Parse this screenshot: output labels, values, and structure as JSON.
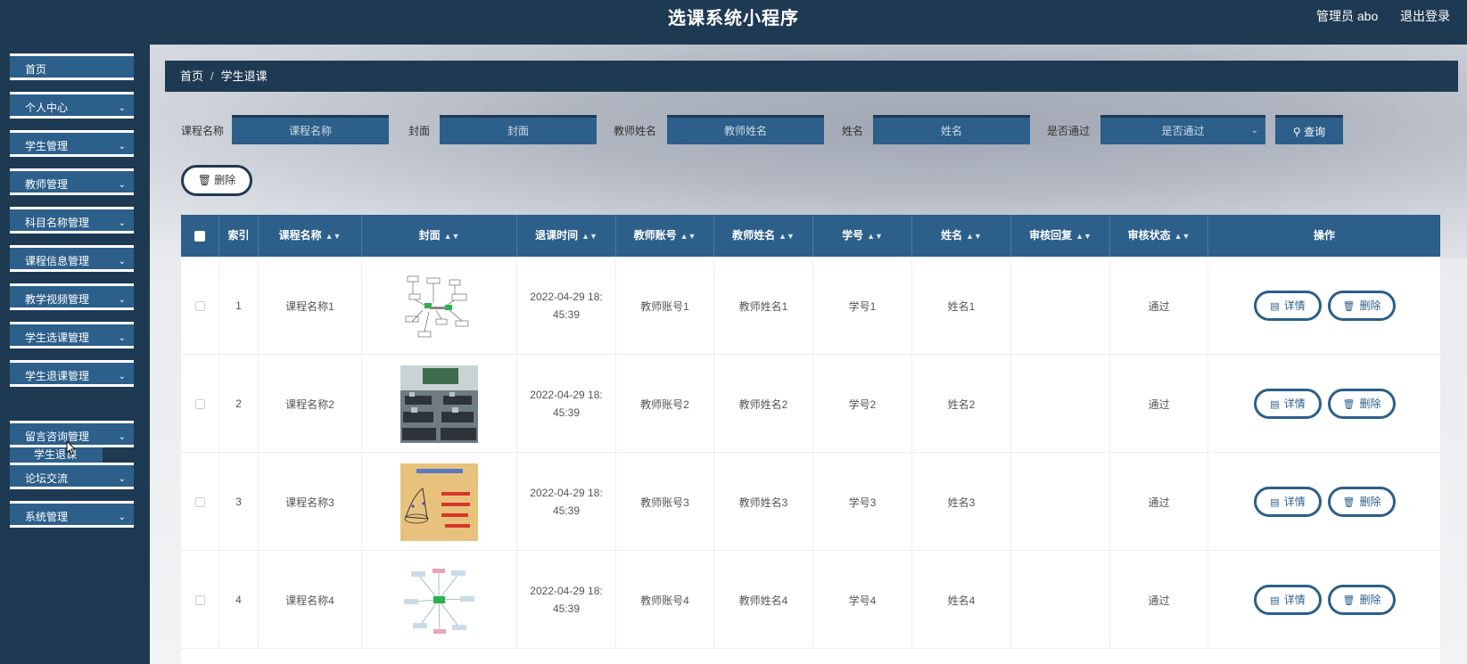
{
  "header": {
    "title": "选课系统小程序",
    "user": "管理员 abo",
    "logout": "退出登录"
  },
  "sidebar": {
    "items": [
      {
        "label": "首页",
        "expandable": false
      },
      {
        "label": "个人中心",
        "expandable": true
      },
      {
        "label": "学生管理",
        "expandable": true
      },
      {
        "label": "教师管理",
        "expandable": true
      },
      {
        "label": "科目名称管理",
        "expandable": true
      },
      {
        "label": "课程信息管理",
        "expandable": true
      },
      {
        "label": "教学视频管理",
        "expandable": true
      },
      {
        "label": "学生选课管理",
        "expandable": true
      },
      {
        "label": "学生退课管理",
        "expandable": true
      },
      {
        "label": "留言咨询管理",
        "expandable": true
      },
      {
        "label": "论坛交流",
        "expandable": true
      },
      {
        "label": "系统管理",
        "expandable": true
      }
    ],
    "sub_item": "学生退课"
  },
  "breadcrumb": {
    "home": "首页",
    "separator": "/",
    "current": "学生退课"
  },
  "filters": {
    "course_label": "课程名称",
    "course_placeholder": "课程名称",
    "cover_label": "封面",
    "cover_placeholder": "封面",
    "teacher_label": "教师姓名",
    "teacher_placeholder": "教师姓名",
    "name_label": "姓名",
    "name_placeholder": "姓名",
    "pass_label": "是否通过",
    "pass_placeholder": "是否通过",
    "query_button": "查询"
  },
  "bulk_delete": "删除",
  "table": {
    "headers": [
      "索引",
      "课程名称",
      "封面",
      "退课时间",
      "教师账号",
      "教师姓名",
      "学号",
      "姓名",
      "审核回复",
      "审核状态",
      "操作"
    ],
    "rows": [
      {
        "index": "1",
        "course": "课程名称1",
        "time_date": "2022-04-29 18:",
        "time_rest": "45:39",
        "teacher_account": "教师账号1",
        "teacher_name": "教师姓名1",
        "student_no": "学号1",
        "name": "姓名1",
        "reply": "",
        "status": "通过",
        "cover": "diagram"
      },
      {
        "index": "2",
        "course": "课程名称2",
        "time_date": "2022-04-29 18:",
        "time_rest": "45:39",
        "teacher_account": "教师账号2",
        "teacher_name": "教师姓名2",
        "student_no": "学号2",
        "name": "姓名2",
        "reply": "",
        "status": "通过",
        "cover": "classroom"
      },
      {
        "index": "3",
        "course": "课程名称3",
        "time_date": "2022-04-29 18:",
        "time_rest": "45:39",
        "teacher_account": "教师账号3",
        "teacher_name": "教师姓名3",
        "student_no": "学号3",
        "name": "姓名3",
        "reply": "",
        "status": "通过",
        "cover": "math"
      },
      {
        "index": "4",
        "course": "课程名称4",
        "time_date": "2022-04-29 18:",
        "time_rest": "45:39",
        "teacher_account": "教师账号4",
        "teacher_name": "教师姓名4",
        "student_no": "学号4",
        "name": "姓名4",
        "reply": "",
        "status": "通过",
        "cover": "mindmap"
      }
    ],
    "detail_label": "详情",
    "delete_label": "删除"
  },
  "colors": {
    "navy": "#1e3a52",
    "accent_blue": "#2c5f8a",
    "white": "#ffffff"
  }
}
